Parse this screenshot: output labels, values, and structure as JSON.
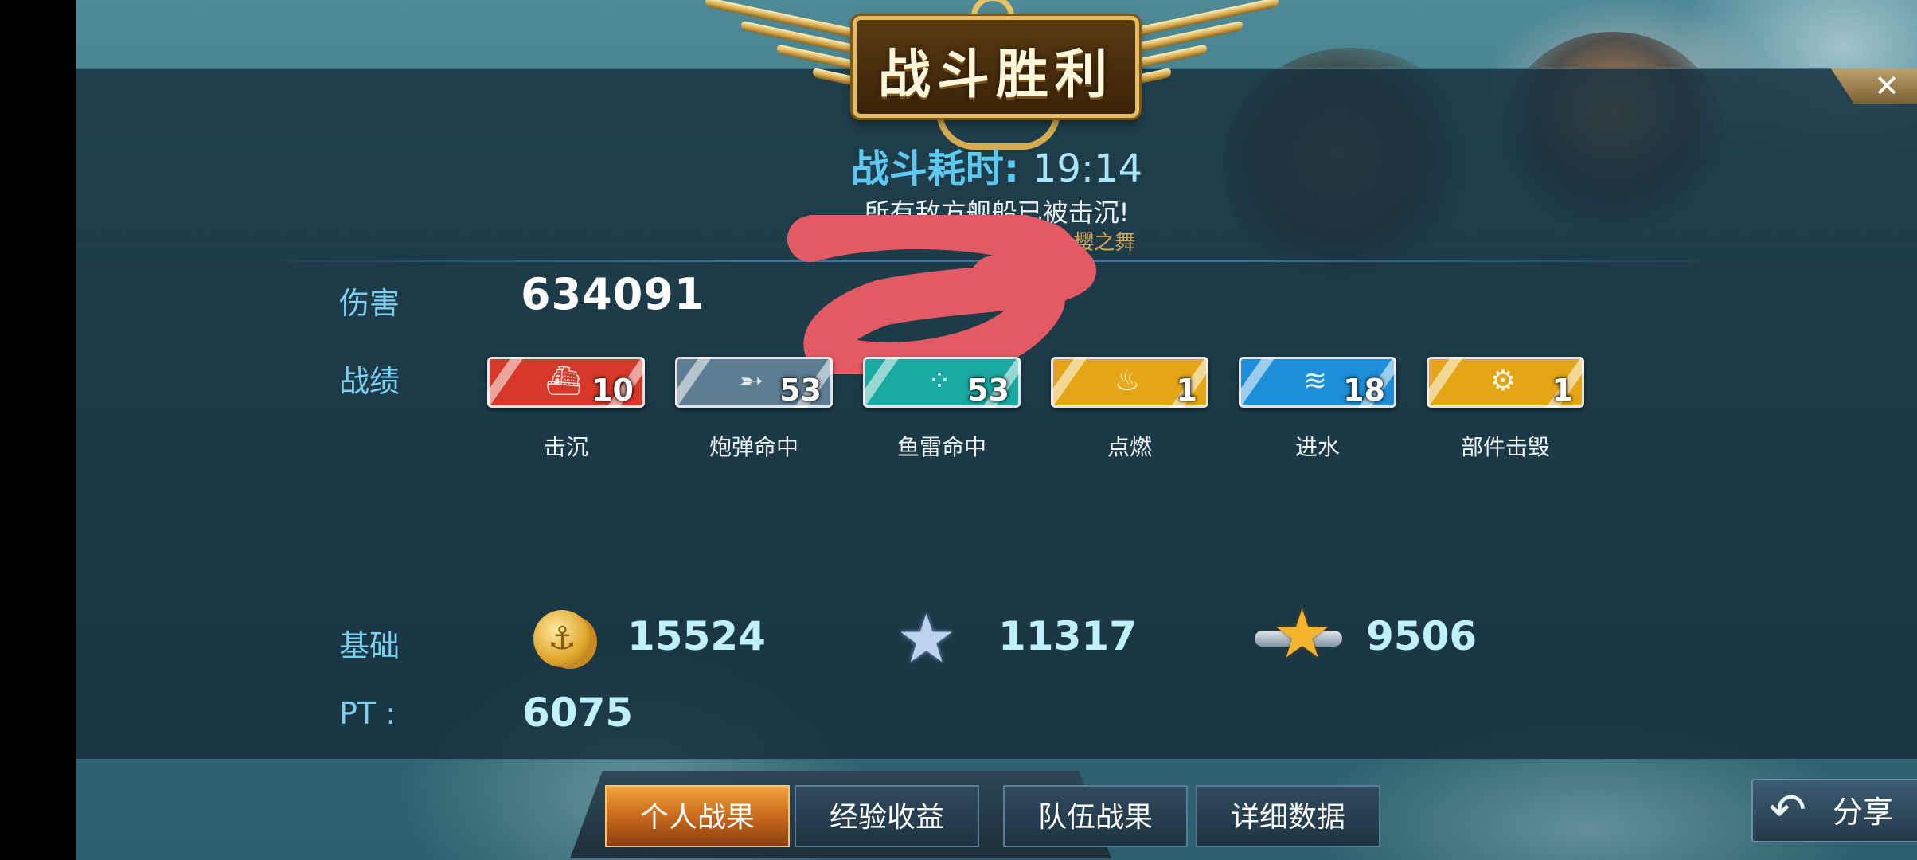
{
  "header": {
    "title": "战斗胜利",
    "close_glyph": "✕"
  },
  "battle": {
    "time_label": "战斗耗时:",
    "time_value": "19:14",
    "result_text": "所有敌方舰船已被击沉!",
    "map_text": "V   岛·樱之舞"
  },
  "damage": {
    "label": "伤害",
    "value": "634091"
  },
  "record": {
    "label": "战绩",
    "badges": [
      {
        "name": "击沉",
        "count": "10",
        "color": "#d8382a",
        "icon": "ship-icon",
        "glyph": "⛴"
      },
      {
        "name": "炮弹命中",
        "count": "53",
        "color": "#5e7d92",
        "icon": "shell-icon",
        "glyph": "➵"
      },
      {
        "name": "鱼雷命中",
        "count": "53",
        "color": "#1aa8a2",
        "icon": "torpedo-icon",
        "glyph": "⁘"
      },
      {
        "name": "点燃",
        "count": "1",
        "color": "#e4a616",
        "icon": "fire-icon",
        "glyph": "♨"
      },
      {
        "name": "进水",
        "count": "18",
        "color": "#1d8fd8",
        "icon": "water-icon",
        "glyph": "≋"
      },
      {
        "name": "部件击毁",
        "count": "1",
        "color": "#e4a616",
        "icon": "gear-icon",
        "glyph": "⚙"
      }
    ]
  },
  "base": {
    "label": "基础",
    "coins": "15524",
    "coin_icon": "anchor-coin-icon",
    "coin_glyph": "⚓",
    "silver_exp": "11317",
    "silver_glyph": "★",
    "gold_exp": "9506",
    "gold_glyph": "★"
  },
  "pt": {
    "label": "PT :",
    "value": "6075"
  },
  "tabs": [
    {
      "label": "个人战果",
      "active": true
    },
    {
      "label": "经验收益",
      "active": false
    },
    {
      "label": "队伍战果",
      "active": false
    },
    {
      "label": "详细数据",
      "active": false
    }
  ],
  "share": {
    "label": "分享",
    "glyph": "↶"
  }
}
